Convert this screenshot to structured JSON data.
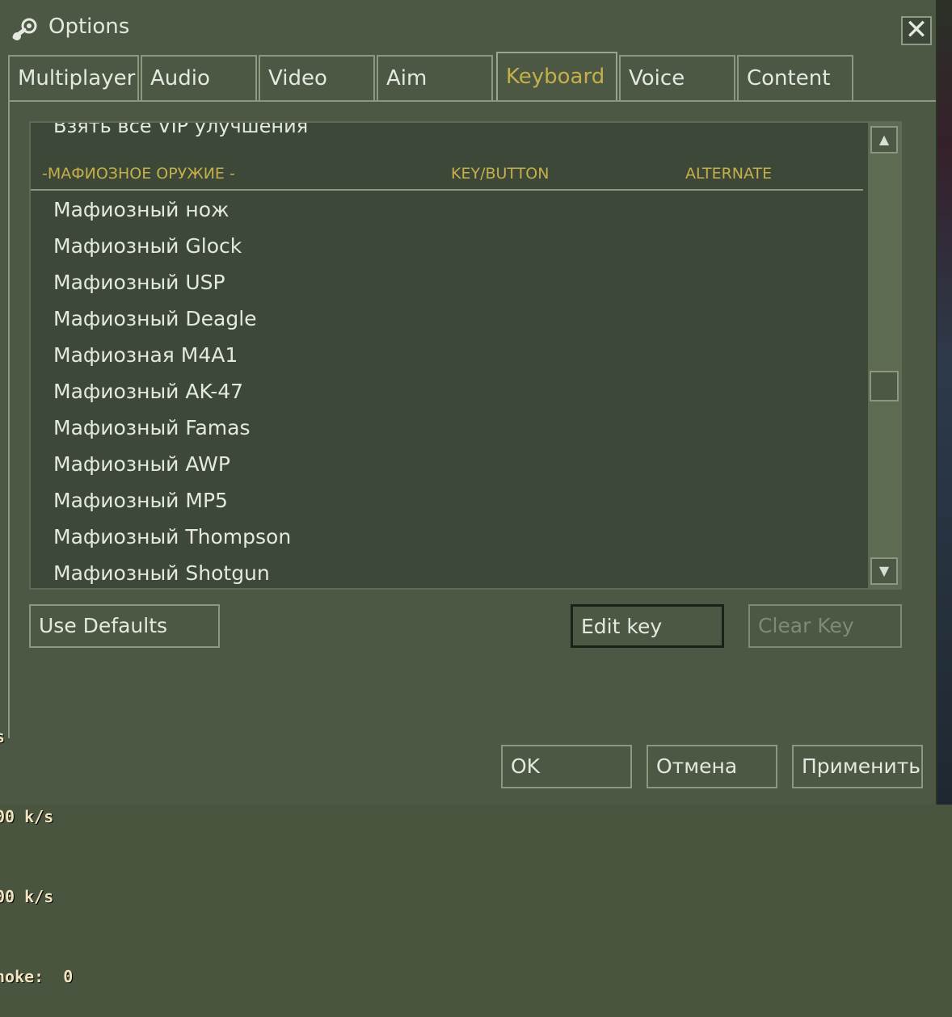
{
  "window": {
    "title": "Options",
    "close_symbol": "✕"
  },
  "tabs": [
    {
      "label": "Multiplayer"
    },
    {
      "label": "Audio"
    },
    {
      "label": "Video"
    },
    {
      "label": "Aim"
    },
    {
      "label": "Keyboard",
      "active": true
    },
    {
      "label": "Voice"
    },
    {
      "label": "Content"
    }
  ],
  "list": {
    "cut_off_row": "Взять все VIP улучшения",
    "headers": {
      "action": "-МАФИОЗНОЕ ОРУЖИЕ -",
      "key": "KEY/BUTTON",
      "alternate": "ALTERNATE"
    },
    "rows": [
      "Мафиозный нож",
      "Мафиозный Glock",
      "Мафиозный USP",
      "Мафиозный Deagle",
      "Мафиозная M4A1",
      "Мафиозный AK-47",
      "Мафиозный Famas",
      "Мафиозный AWP",
      "Мафиозный MP5",
      "Мафиозный Thompson",
      "Мафиозный Shotgun"
    ],
    "scroll_fraction": 0.58
  },
  "buttons": {
    "use_defaults": "Use Defaults",
    "edit_key": "Edit key",
    "clear_key": "Clear Key",
    "ok": "OK",
    "cancel": "Отмена",
    "apply": "Применить"
  },
  "netgraph": {
    "line1": "s",
    "line2": "00 k/s",
    "line3": "00 k/s",
    "line4": "hoke:  0"
  },
  "colors": {
    "accent": "#c4b04a",
    "panel_bg": "#4c5844",
    "list_bg": "#3e4838"
  },
  "icons": {
    "window_icon": "steam-icon",
    "close": "close-icon",
    "scroll_up": "arrow-up-icon",
    "scroll_down": "arrow-down-icon"
  }
}
